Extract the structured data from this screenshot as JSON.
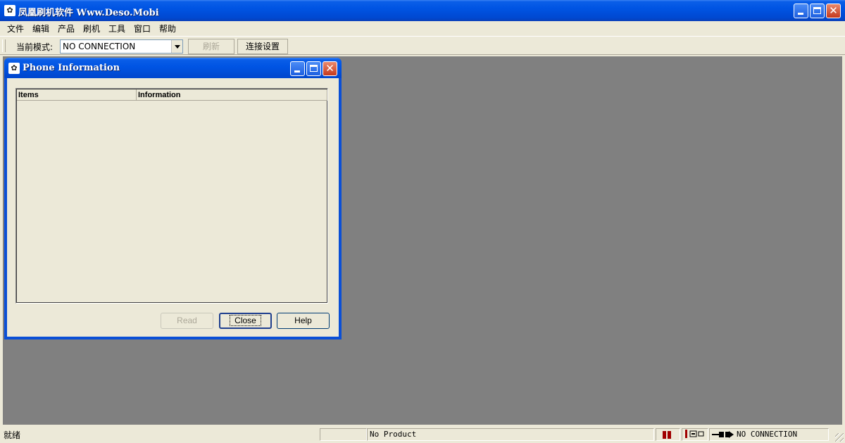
{
  "window": {
    "title": "凤凰刷机软件 Www.Deso.Mobi",
    "icon": "phoenix-app-icon",
    "buttons": [
      "minimize-icon",
      "maximize-icon",
      "close-icon"
    ]
  },
  "menu": {
    "items": [
      "文件",
      "编辑",
      "产品",
      "刷机",
      "工具",
      "窗口",
      "帮助"
    ]
  },
  "toolbar": {
    "mode_label": "当前模式:",
    "mode_value": "NO CONNECTION",
    "refresh_label": "刷新",
    "connect_settings_label": "连接设置"
  },
  "child_window": {
    "title": "Phone Information",
    "columns": [
      "Items",
      "Information"
    ],
    "rows": [],
    "buttons": {
      "read": "Read",
      "close": "Close",
      "help": "Help"
    }
  },
  "statusbar": {
    "status_text": "就绪",
    "product": "No Product",
    "connection": "NO CONNECTION",
    "icons": [
      "signal-bars-icon",
      "port-icon",
      "plug-icon"
    ]
  },
  "colors": {
    "titlebar_blue": "#0054e3",
    "workspace_gray": "#808080",
    "face": "#ece9d8"
  }
}
